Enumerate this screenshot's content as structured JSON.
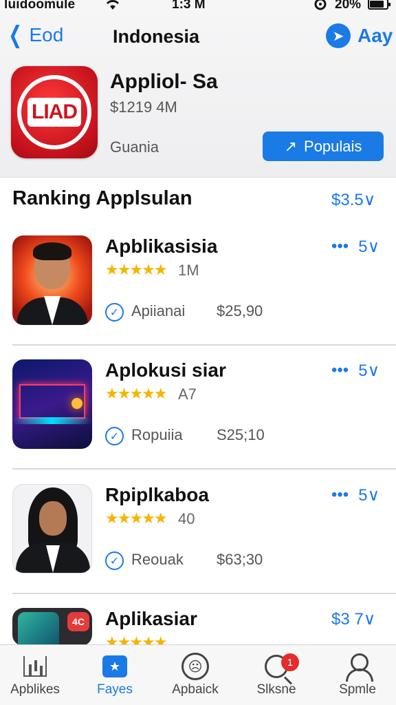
{
  "status": {
    "carrier": "luidoomule",
    "time": "1:3 M",
    "battery": "20%"
  },
  "nav": {
    "back_label": "Eod",
    "title": "Indonesia",
    "right_label": "Aay"
  },
  "featured": {
    "icon_text": "LIAD",
    "name": "Appliol- Sa",
    "price": "$1219 4M",
    "category": "Guania",
    "button_label": "Populais"
  },
  "section": {
    "title": "Ranking Applsulan",
    "link": "$3.5∨"
  },
  "apps": [
    {
      "name": "Apblikasisia",
      "rating": "1M",
      "tag": "Apiianai",
      "price": "$25,90",
      "more": "5∨"
    },
    {
      "name": "Aplokusi siar",
      "rating": "A7",
      "tag": "Ropuiia",
      "price": "S25;10",
      "more": "5∨"
    },
    {
      "name": "Rpiplkaboa",
      "rating": "40",
      "tag": "Reouak",
      "price": "$63;30",
      "more": "5∨"
    },
    {
      "name": "Aplikasiar",
      "rating": "",
      "tag": "",
      "price": "",
      "more": "$3 7∨",
      "thumb_badge": "4C"
    }
  ],
  "tabs": [
    {
      "label": "Apblikes",
      "icon": "chart-icon"
    },
    {
      "label": "Fayes",
      "icon": "favorites-icon"
    },
    {
      "label": "Apbaick",
      "icon": "face-icon"
    },
    {
      "label": "Slksne",
      "icon": "search-icon",
      "badge": "1"
    },
    {
      "label": "Spmle",
      "icon": "person-icon"
    }
  ],
  "colors": {
    "accent": "#1a7ae6",
    "star": "#f5b400",
    "badge": "#e52b2b"
  }
}
